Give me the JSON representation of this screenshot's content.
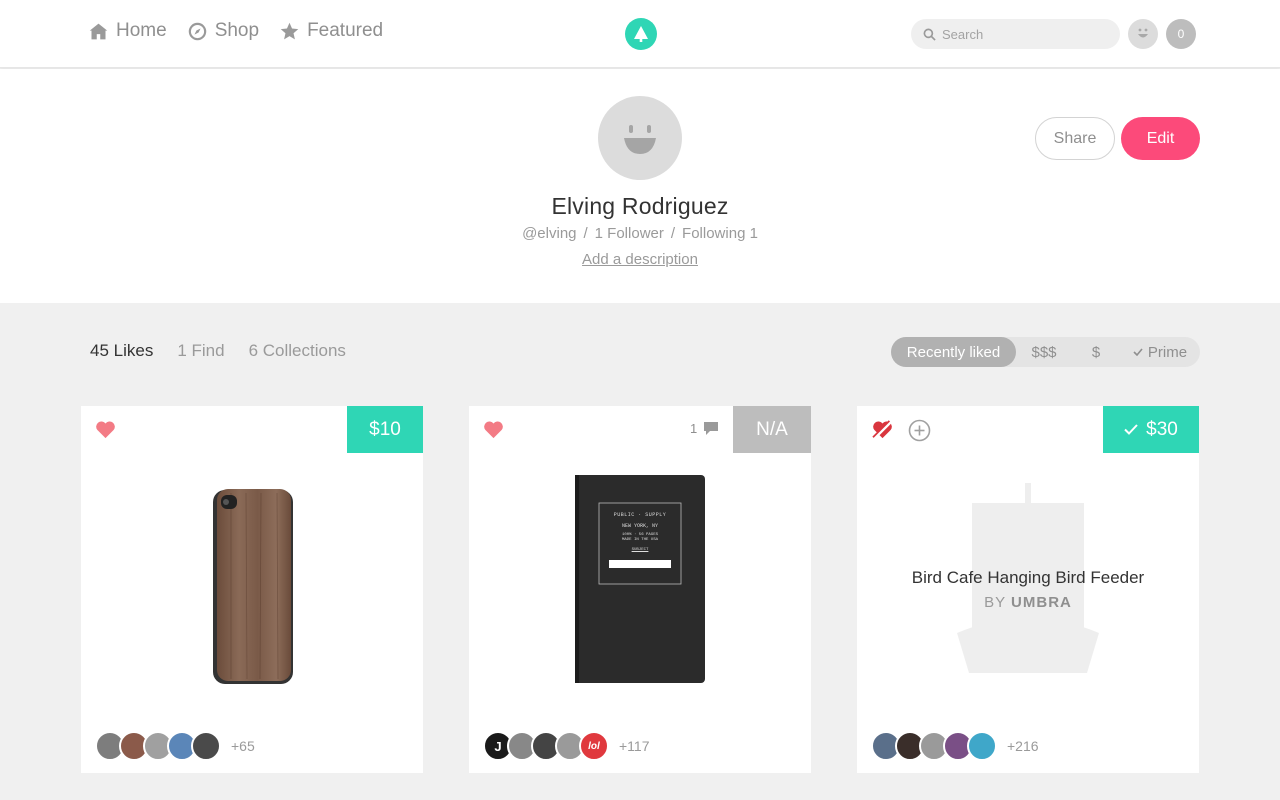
{
  "nav": {
    "items": [
      {
        "label": "Home",
        "icon": "home-icon"
      },
      {
        "label": "Shop",
        "icon": "compass-icon"
      },
      {
        "label": "Featured",
        "icon": "star-icon"
      }
    ],
    "search_placeholder": "Search",
    "cart_count": "0"
  },
  "profile": {
    "name": "Elving Rodriguez",
    "handle": "@elving",
    "followers": "1 Follower",
    "following": "Following 1",
    "separator": "/",
    "description_link": "Add a description",
    "share_label": "Share",
    "edit_label": "Edit"
  },
  "tabs": [
    {
      "label": "45 Likes",
      "active": true
    },
    {
      "label": "1 Find",
      "active": false
    },
    {
      "label": "6 Collections",
      "active": false
    }
  ],
  "sort": {
    "options": [
      "Recently liked",
      "$$$",
      "$",
      "Prime"
    ],
    "active": "Recently liked"
  },
  "cards": [
    {
      "price": "$10",
      "price_style": "green",
      "liked": true,
      "liker_count": "+65",
      "image": "wood-phone-case"
    },
    {
      "price": "N/A",
      "price_style": "grey",
      "liked": true,
      "comments": "1",
      "liker_count": "+117",
      "image": "black-notebook",
      "notebook_lines": [
        "PUBLIC · SUPPLY",
        "NEW YORK, NY",
        "100% · 56 PAGES",
        "MADE IN THE USA",
        "SUBJECT"
      ]
    },
    {
      "price": "$30",
      "price_style": "green",
      "checked": true,
      "liked": false,
      "liker_count": "+216",
      "title": "Bird Cafe Hanging Bird Feeder",
      "brand_by": "BY",
      "brand": "UMBRA",
      "image": "bird-feeder"
    }
  ],
  "colors": {
    "accent_green": "#2fd6b5",
    "edit_pink": "#fc4a7a",
    "heart": "#f37b85",
    "unlike_red": "#d9363e"
  }
}
